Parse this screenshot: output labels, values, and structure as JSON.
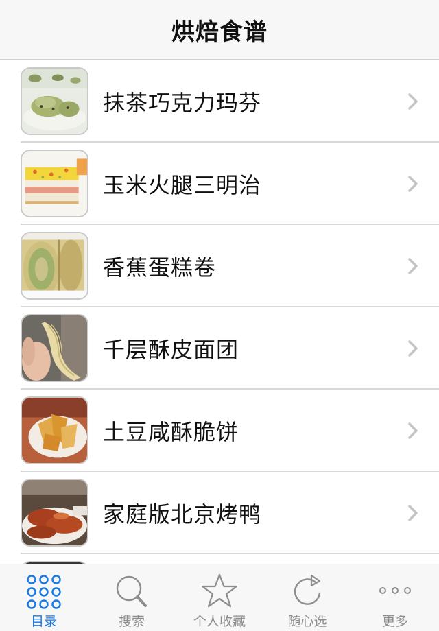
{
  "navbar": {
    "title": "烘焙食谱"
  },
  "recipes": [
    {
      "name": "抹茶巧克力玛芬",
      "thumb": "matcha-muffin"
    },
    {
      "name": "玉米火腿三明治",
      "thumb": "corn-ham-sandwich"
    },
    {
      "name": "香蕉蛋糕卷",
      "thumb": "banana-cake-roll"
    },
    {
      "name": "千层酥皮面团",
      "thumb": "puff-pastry-dough"
    },
    {
      "name": "土豆咸酥脆饼",
      "thumb": "potato-crisp"
    },
    {
      "name": "家庭版北京烤鸭",
      "thumb": "peking-duck"
    }
  ],
  "tabbar": {
    "active": "catalog",
    "tabs": [
      {
        "id": "catalog",
        "label": "目录",
        "icon": "grid-dots-icon"
      },
      {
        "id": "search",
        "label": "搜索",
        "icon": "search-icon"
      },
      {
        "id": "favorites",
        "label": "个人收藏",
        "icon": "star-icon"
      },
      {
        "id": "random",
        "label": "随心选",
        "icon": "refresh-icon"
      },
      {
        "id": "more",
        "label": "更多",
        "icon": "more-dots-icon"
      }
    ]
  },
  "colors": {
    "accent": "#1a7ae6",
    "inactive": "#8e8e8e",
    "bar_bg": "#f7f7f7",
    "chevron": "#c4c4c4"
  }
}
